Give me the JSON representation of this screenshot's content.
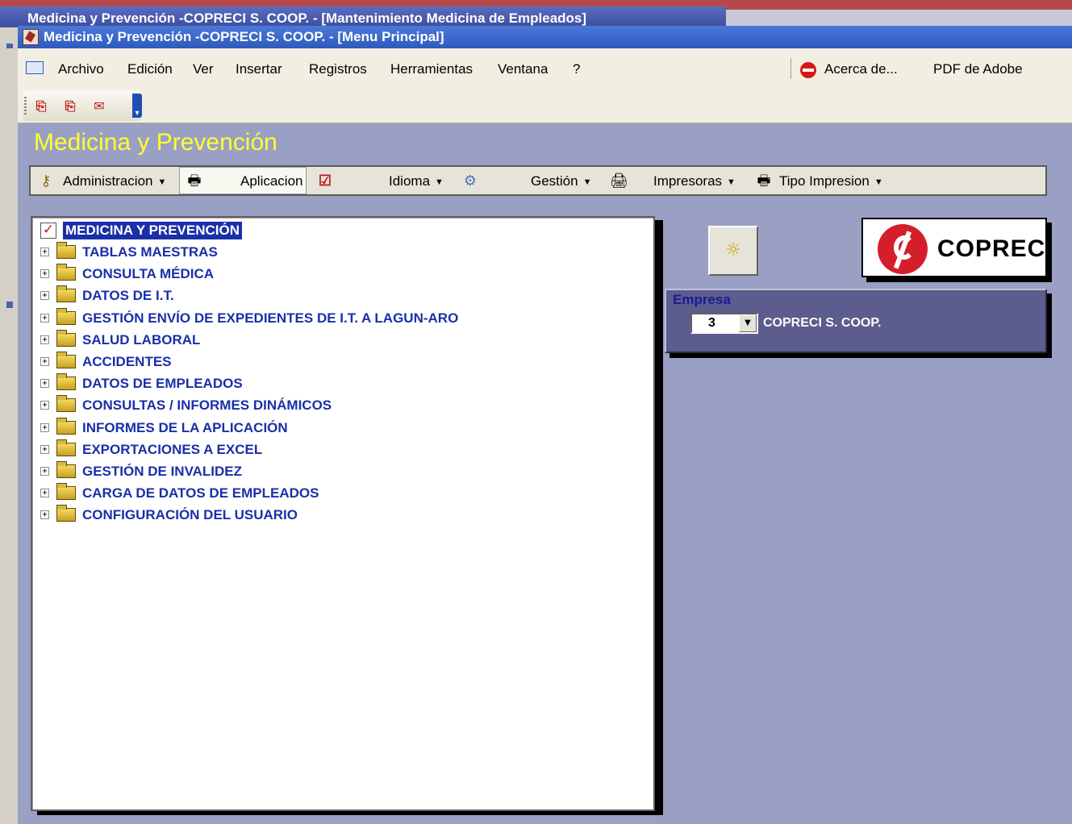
{
  "back_window": {
    "title": "Medicina y Prevención -COPRECI S. COOP. - [Mantenimiento Medicina de Empleados]"
  },
  "window": {
    "title": "Medicina y Prevención -COPRECI S. COOP. - [Menu Principal]"
  },
  "menu": {
    "items": [
      "Archivo",
      "Edición",
      "Ver",
      "Insertar",
      "Registros",
      "Herramientas",
      "Ventana",
      "?"
    ],
    "acerca": "Acerca de...",
    "pdf": "PDF de Adobe"
  },
  "toolbar": {
    "icons": [
      "pdf-icon",
      "pdf-icon",
      "pdf-mail-icon"
    ]
  },
  "form": {
    "title": "Medicina y Prevención",
    "toolbar": {
      "administracion": "Administracion",
      "aplicacion": "Aplicacion",
      "idioma": "Idioma",
      "gestion": "Gestión",
      "impresoras": "Impresoras",
      "tipo_impresion": "Tipo Impresion"
    }
  },
  "tree": {
    "root": "MEDICINA Y PREVENCIÓN",
    "items": [
      "TABLAS MAESTRAS",
      "CONSULTA MÉDICA",
      "DATOS DE I.T.",
      "GESTIÓN ENVÍO DE EXPEDIENTES DE I.T. A LAGUN-ARO",
      "SALUD LABORAL",
      "ACCIDENTES",
      "DATOS DE EMPLEADOS",
      "CONSULTAS / INFORMES DINÁMICOS",
      "INFORMES DE LA APLICACIÓN",
      "EXPORTACIONES A EXCEL",
      "GESTIÓN DE INVALIDEZ",
      "CARGA DE DATOS DE EMPLEADOS",
      "CONFIGURACIÓN DEL USUARIO"
    ]
  },
  "logo": {
    "text": "COPRECI"
  },
  "empresa": {
    "label": "Empresa",
    "value": "3",
    "name": "COPRECI S. COOP."
  },
  "colors": {
    "title_yellow": "#ffff30",
    "tree_text": "#1a2fa8",
    "form_bg": "#9aa0c4",
    "title_bar": "#2d5bbd"
  }
}
